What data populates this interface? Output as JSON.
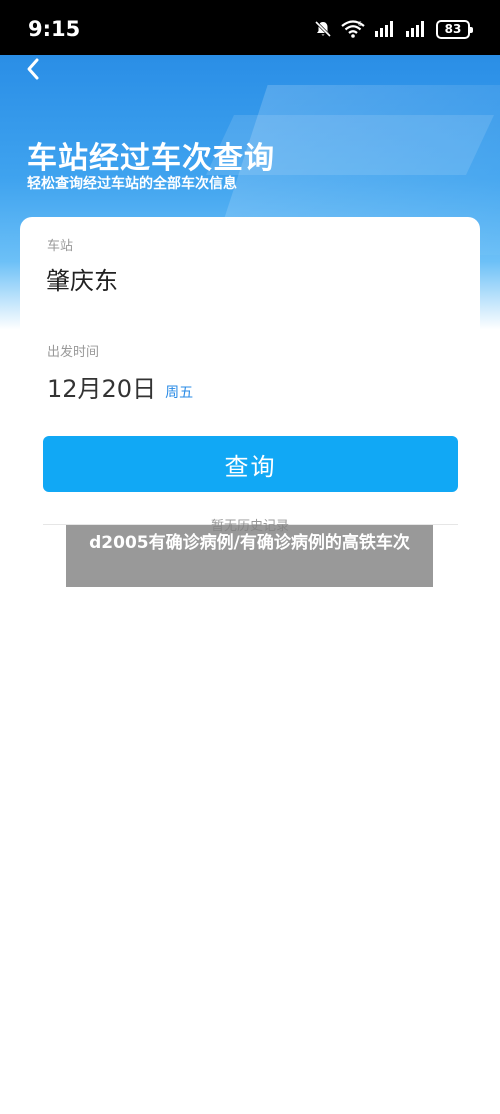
{
  "status_bar": {
    "time": "9:15",
    "battery": "83",
    "icons": [
      "mute-icon",
      "wifi-6-icon",
      "signal-icon",
      "signal-icon",
      "battery-icon"
    ]
  },
  "header": {
    "title": "车站经过车次查询",
    "subtitle": "轻松查询经过车站的全部车次信息"
  },
  "form": {
    "station_label": "车站",
    "station_value": "肇庆东",
    "date_label": "出发时间",
    "date_value": "12月20日",
    "weekday": "周五",
    "query_button": "查询",
    "history_text": "暂无历史记录"
  },
  "overlay": {
    "text": "d2005有确诊病例/有确诊病例的高铁车次"
  },
  "colors": {
    "accent": "#11a8f5",
    "hero_blue": "#2a8ee6",
    "weekday_blue": "#2a8be6"
  }
}
